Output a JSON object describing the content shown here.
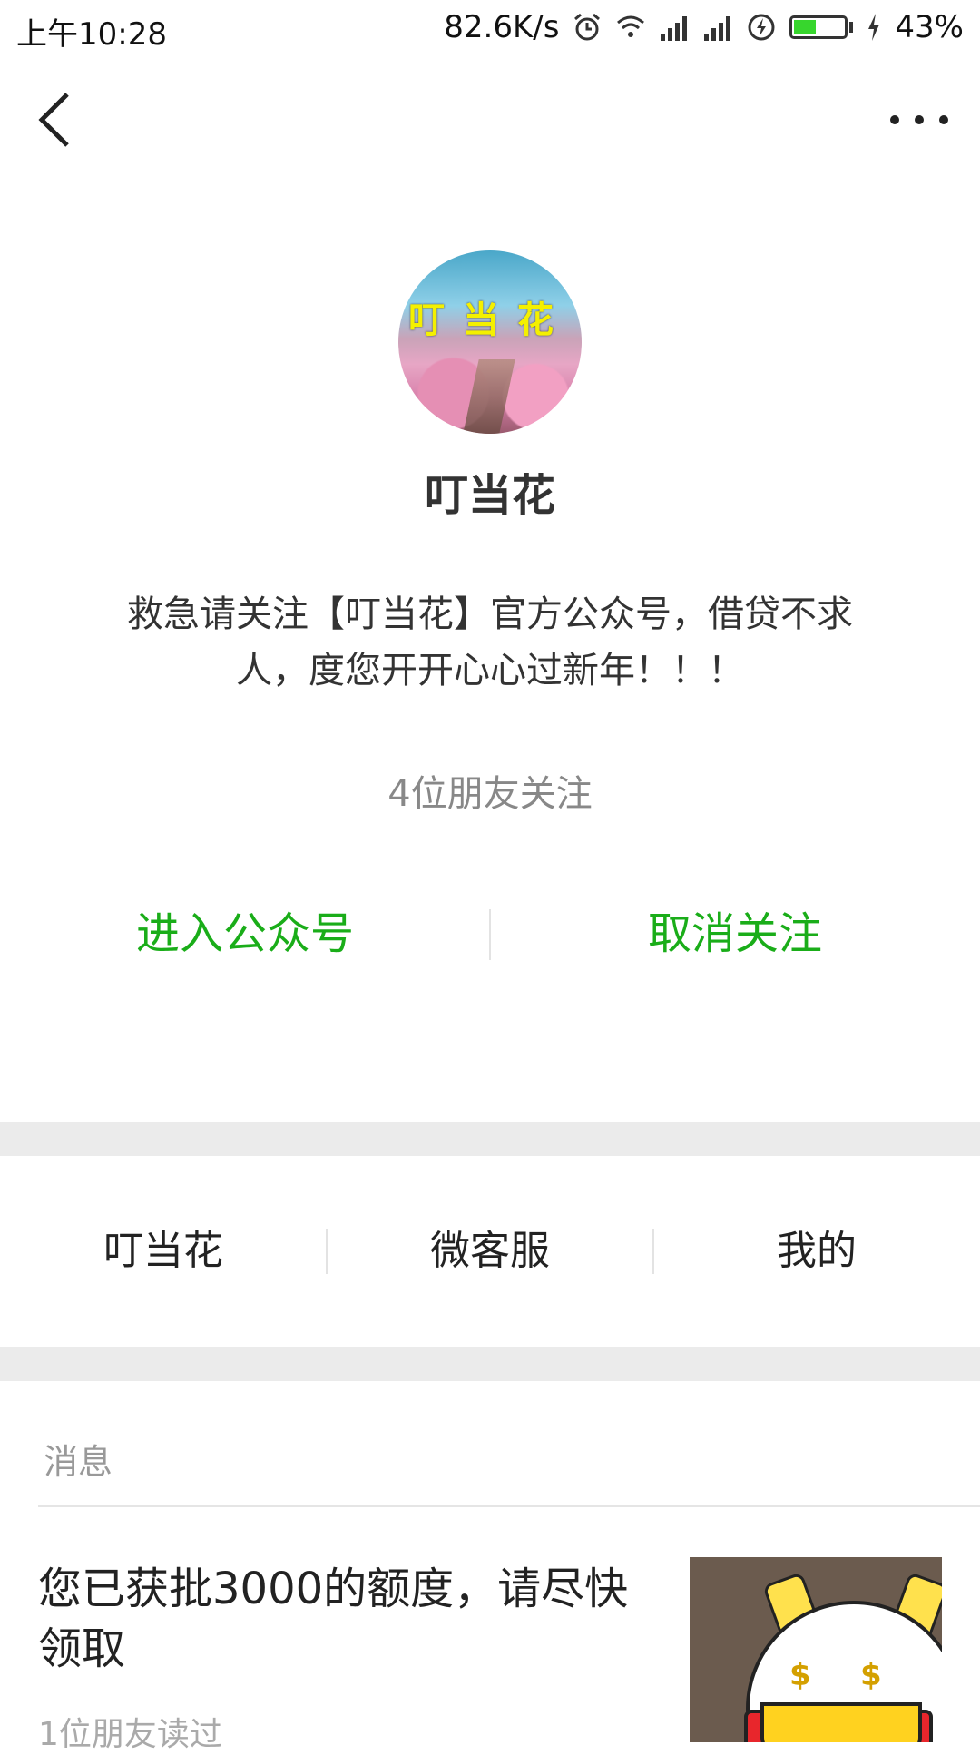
{
  "status_bar": {
    "time": "上午10:28",
    "speed": "82.6K/s",
    "battery": "43%",
    "battery_level": 0.43,
    "battery_color": "#37d62d"
  },
  "nav": {
    "back_icon": "chevron-left-icon",
    "more_icon": "more-dots-icon"
  },
  "profile": {
    "avatar_caption": "叮当花",
    "name": "叮当花",
    "intro": "救急请关注【叮当花】官方公众号，借贷不求人，度您开开心心过新年！！！",
    "friends_following": "4位朋友关注"
  },
  "actions": {
    "enter": "进入公众号",
    "unfollow": "取消关注",
    "accent_color": "#1aad19"
  },
  "menu": {
    "items": [
      {
        "label": "叮当花"
      },
      {
        "label": "微客服"
      },
      {
        "label": "我的"
      }
    ]
  },
  "messages": {
    "section_title": "消息",
    "items": [
      {
        "title": "您已获批3000的额度，请尽快领取",
        "meta": "1位朋友读过"
      }
    ]
  }
}
